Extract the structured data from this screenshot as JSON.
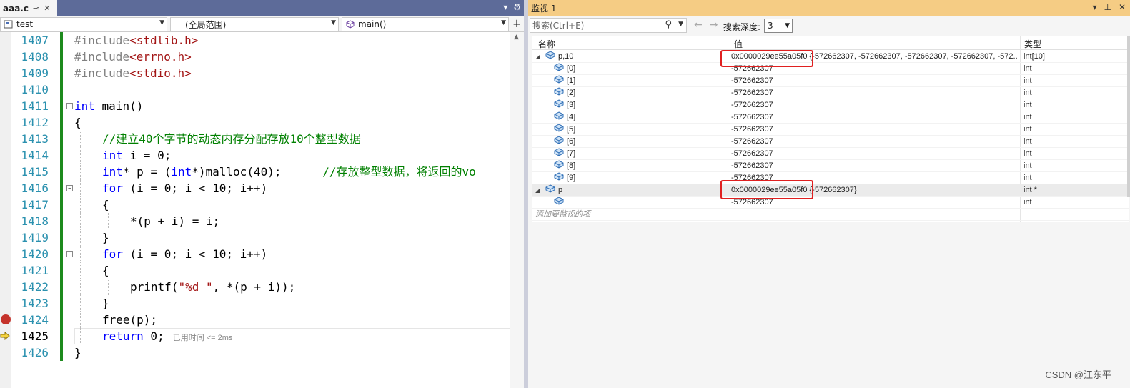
{
  "editor": {
    "tab_title": "aaa.c",
    "tab_pin": "⊸",
    "tab_close": "✕",
    "project_combo": "test",
    "scope_combo": "(全局范围)",
    "function_combo": "main()",
    "lines": [
      {
        "num": "1407",
        "tokens": [
          {
            "t": "#include",
            "c": "pp"
          },
          {
            "t": "<stdlib.h>",
            "c": "str"
          }
        ]
      },
      {
        "num": "1408",
        "tokens": [
          {
            "t": "#include",
            "c": "pp"
          },
          {
            "t": "<errno.h>",
            "c": "str"
          }
        ]
      },
      {
        "num": "1409",
        "tokens": [
          {
            "t": "#include",
            "c": "pp"
          },
          {
            "t": "<stdio.h>",
            "c": "str"
          }
        ]
      },
      {
        "num": "1410",
        "tokens": []
      },
      {
        "num": "1411",
        "fold": true,
        "tokens": [
          {
            "t": "int",
            "c": "kw"
          },
          {
            "t": " main()",
            "c": "op"
          }
        ]
      },
      {
        "num": "1412",
        "tokens": [
          {
            "t": "{",
            "c": "op"
          }
        ]
      },
      {
        "num": "1413",
        "indent": 1,
        "tokens": [
          {
            "t": "//建立40个字节的动态内存分配存放10个整型数据",
            "c": "cmt"
          }
        ]
      },
      {
        "num": "1414",
        "indent": 1,
        "tokens": [
          {
            "t": "int",
            "c": "kw"
          },
          {
            "t": " i = 0;",
            "c": "op"
          }
        ]
      },
      {
        "num": "1415",
        "indent": 1,
        "tokens": [
          {
            "t": "int",
            "c": "kw"
          },
          {
            "t": "* p = (",
            "c": "op"
          },
          {
            "t": "int",
            "c": "kw"
          },
          {
            "t": "*)malloc(40);      ",
            "c": "op"
          },
          {
            "t": "//存放整型数据，将返回的vo",
            "c": "cmt"
          }
        ]
      },
      {
        "num": "1416",
        "indent": 1,
        "fold": true,
        "tokens": [
          {
            "t": "for",
            "c": "kw"
          },
          {
            "t": " (i = 0; i < 10; i++)",
            "c": "op"
          }
        ]
      },
      {
        "num": "1417",
        "indent": 1,
        "tokens": [
          {
            "t": "{",
            "c": "op"
          }
        ]
      },
      {
        "num": "1418",
        "indent": 2,
        "tokens": [
          {
            "t": "*(p + i) = i;",
            "c": "op"
          }
        ]
      },
      {
        "num": "1419",
        "indent": 1,
        "tokens": [
          {
            "t": "}",
            "c": "op"
          }
        ]
      },
      {
        "num": "1420",
        "indent": 1,
        "fold": true,
        "tokens": [
          {
            "t": "for",
            "c": "kw"
          },
          {
            "t": " (i = 0; i < 10; i++)",
            "c": "op"
          }
        ]
      },
      {
        "num": "1421",
        "indent": 1,
        "tokens": [
          {
            "t": "{",
            "c": "op"
          }
        ]
      },
      {
        "num": "1422",
        "indent": 2,
        "tokens": [
          {
            "t": "printf(",
            "c": "op"
          },
          {
            "t": "\"%d \"",
            "c": "str"
          },
          {
            "t": ", *(p + i));",
            "c": "op"
          }
        ]
      },
      {
        "num": "1423",
        "indent": 1,
        "tokens": [
          {
            "t": "}",
            "c": "op"
          }
        ]
      },
      {
        "num": "1424",
        "indent": 1,
        "breakpoint": true,
        "tokens": [
          {
            "t": "free(p);",
            "c": "op"
          }
        ]
      },
      {
        "num": "1425",
        "indent": 1,
        "current": true,
        "hint": "已用时间 <= 2ms",
        "tokens": [
          {
            "t": "return",
            "c": "kw"
          },
          {
            "t": " 0;",
            "c": "op"
          }
        ]
      },
      {
        "num": "1426",
        "tokens": [
          {
            "t": "}",
            "c": "op"
          }
        ]
      }
    ]
  },
  "watch": {
    "title": "监视 1",
    "search_placeholder": "搜索(Ctrl+E)",
    "depth_label": "搜索深度:",
    "depth_value": "3",
    "col_name": "名称",
    "col_value": "值",
    "col_type": "类型",
    "rows": [
      {
        "level": 0,
        "expanded": true,
        "name": "p,10",
        "value": "0x0000029ee55a05f0 {-572662307, -572662307, -572662307, -572662307, -572...",
        "type": "int[10]"
      },
      {
        "level": 1,
        "name": "[0]",
        "value": "-572662307",
        "type": "int"
      },
      {
        "level": 1,
        "name": "[1]",
        "value": "-572662307",
        "type": "int"
      },
      {
        "level": 1,
        "name": "[2]",
        "value": "-572662307",
        "type": "int"
      },
      {
        "level": 1,
        "name": "[3]",
        "value": "-572662307",
        "type": "int"
      },
      {
        "level": 1,
        "name": "[4]",
        "value": "-572662307",
        "type": "int"
      },
      {
        "level": 1,
        "name": "[5]",
        "value": "-572662307",
        "type": "int"
      },
      {
        "level": 1,
        "name": "[6]",
        "value": "-572662307",
        "type": "int"
      },
      {
        "level": 1,
        "name": "[7]",
        "value": "-572662307",
        "type": "int"
      },
      {
        "level": 1,
        "name": "[8]",
        "value": "-572662307",
        "type": "int"
      },
      {
        "level": 1,
        "name": "[9]",
        "value": "-572662307",
        "type": "int"
      },
      {
        "level": 0,
        "expanded": true,
        "selected": true,
        "name": "p",
        "value": "0x0000029ee55a05f0 {-572662307}",
        "type": "int *"
      },
      {
        "level": 1,
        "name": "",
        "value": "-572662307",
        "type": "int"
      }
    ],
    "add_item": "添加要监视的项"
  },
  "watermark": "CSDN @江东平",
  "colors": {
    "tabbar": "#5d6b99",
    "watch_title": "#f5cc84",
    "keyword": "#0000ff",
    "comment": "#008000",
    "string": "#a31515",
    "breakpoint": "#c5332b",
    "highlight_box": "#e02020"
  }
}
